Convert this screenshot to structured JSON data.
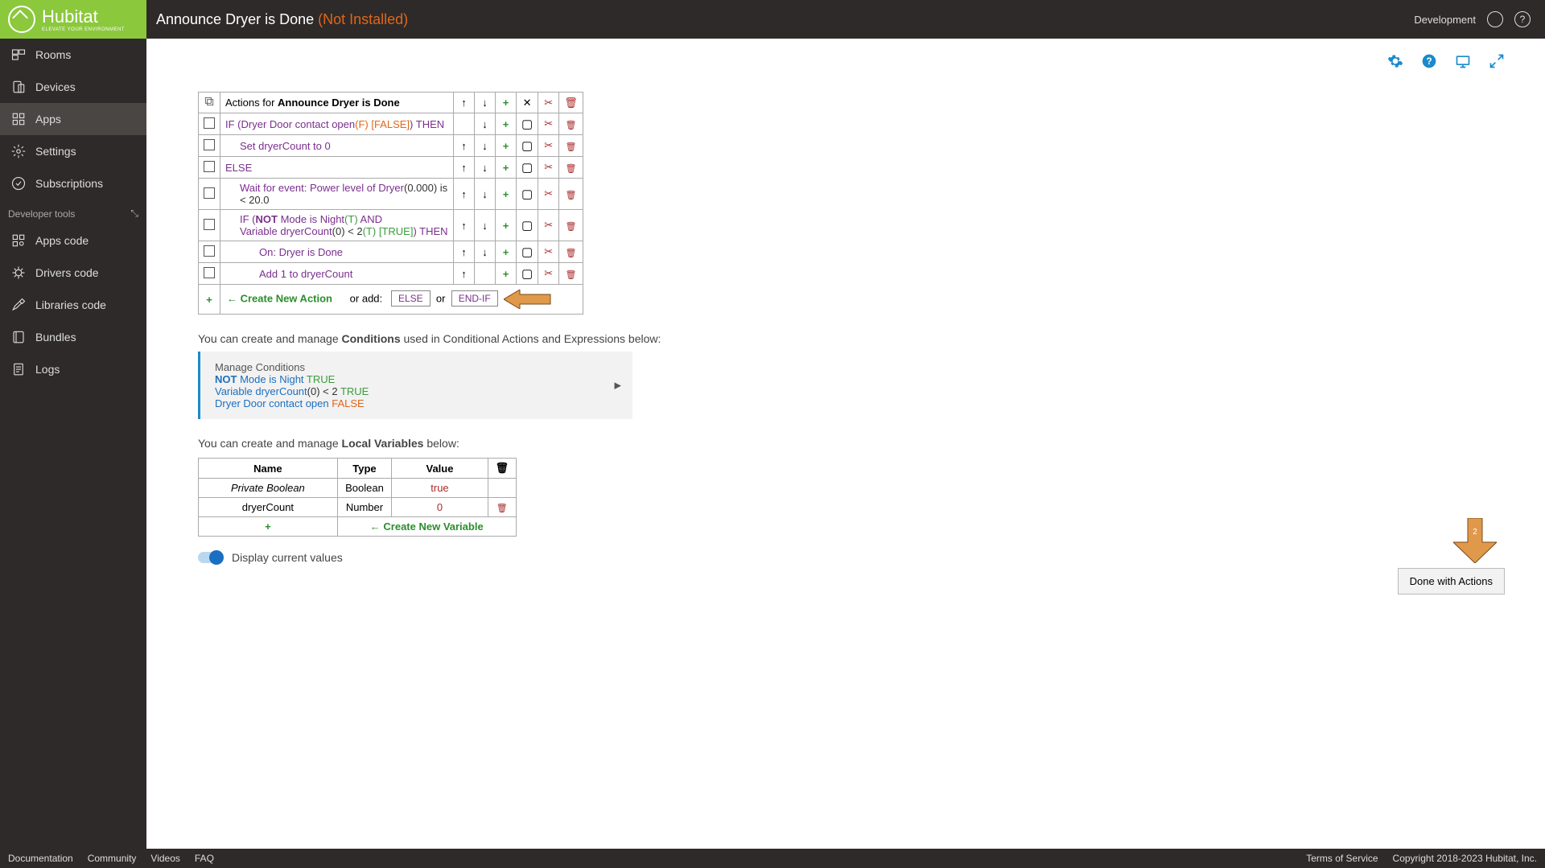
{
  "header": {
    "logo_text": "Hubitat",
    "logo_subtitle": "ELEVATE YOUR ENVIRONMENT",
    "title": "Announce Dryer is Done ",
    "status": "(Not Installed)",
    "dev_label": "Development"
  },
  "sidebar": {
    "items": [
      {
        "label": "Rooms"
      },
      {
        "label": "Devices"
      },
      {
        "label": "Apps"
      },
      {
        "label": "Settings"
      },
      {
        "label": "Subscriptions"
      }
    ],
    "dev_section": "Developer tools",
    "dev_items": [
      {
        "label": "Apps code"
      },
      {
        "label": "Drivers code"
      },
      {
        "label": "Libraries code"
      },
      {
        "label": "Bundles"
      },
      {
        "label": "Logs"
      }
    ]
  },
  "actions": {
    "header_prefix": "Actions for ",
    "header_name": "Announce Dryer is Done",
    "create_action": "← Create New Action",
    "or_add": "or add:",
    "else_btn": "ELSE",
    "or_text": "or",
    "endif_btn": "END-IF",
    "rows": [
      {
        "text": "IF (Dryer Door contact open",
        "suffix_orange": "(F) ",
        "suffix_orange2": "[FALSE]",
        "suffix2": ") THEN",
        "indent": 0
      },
      {
        "text": "Set dryerCount to 0",
        "indent": 1
      },
      {
        "text": "ELSE",
        "indent": 0
      },
      {
        "text": "Wait for event: Power level of Dryer",
        "suffix_black": "(0.000) is < 20.0",
        "indent": 1
      },
      {
        "text": "IF (",
        "not": "NOT",
        "text2": " Mode is Night",
        "suffix_green": "(T)",
        "and": "  AND",
        "line2_pre": "Variable dryerCount",
        "line2_black": "(0) < 2",
        "line2_green": "(T) ",
        "line2_green2": "[TRUE]",
        "line2_then": ") THEN",
        "indent": 1
      },
      {
        "text": "On: Dryer is Done",
        "indent": 2
      },
      {
        "text": "Add 1 to dryerCount",
        "indent": 2
      }
    ]
  },
  "conditions": {
    "intro_prefix": "You can create and manage ",
    "intro_bold": "Conditions",
    "intro_suffix": " used in Conditional Actions and Expressions below:",
    "manage": "Manage Conditions",
    "c1_not": "NOT",
    "c1_text": " Mode is Night ",
    "c1_val": "TRUE",
    "c2_text": "Variable dryerCount",
    "c2_mid": "(0) < 2 ",
    "c2_val": "TRUE",
    "c3_text": "Dryer Door contact open ",
    "c3_val": "FALSE"
  },
  "vars": {
    "intro_prefix": "You can create and manage ",
    "intro_bold": "Local Variables",
    "intro_suffix": " below:",
    "headers": {
      "name": "Name",
      "type": "Type",
      "value": "Value"
    },
    "rows": [
      {
        "name": "Private Boolean",
        "type": "Boolean",
        "value": "true",
        "italic": true
      },
      {
        "name": "dryerCount",
        "type": "Number",
        "value": "0",
        "italic": false
      }
    ],
    "create_var": "← Create New Variable"
  },
  "toggle_label": "Display current values",
  "done_button": "Done with Actions",
  "footer": {
    "links": [
      "Documentation",
      "Community",
      "Videos",
      "FAQ"
    ],
    "tos": "Terms of Service",
    "copyright": "Copyright 2018-2023 Hubitat, Inc."
  }
}
